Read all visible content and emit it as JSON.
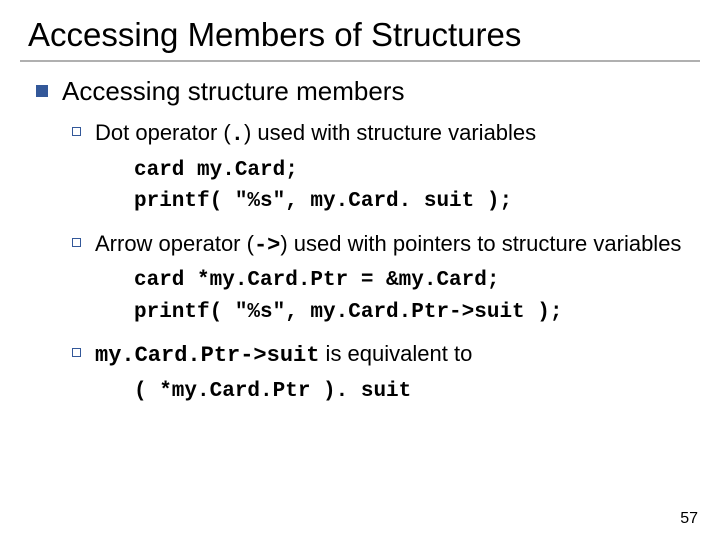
{
  "title": "Accessing Members of Structures",
  "section": "Accessing structure members",
  "items": [
    {
      "prefix": "Dot operator (",
      "op": ".",
      "suffix": ") used with structure variables",
      "code": "card my.Card;\nprintf( \"%s\", my.Card. suit );"
    },
    {
      "prefix": "Arrow operator (",
      "op": "->",
      "suffix": ") used with pointers to structure variables",
      "code": "card *my.Card.Ptr = &my.Card;\nprintf( \"%s\", my.Card.Ptr->suit );"
    },
    {
      "equiv_expr": "my.Card.Ptr->suit",
      "equiv_tail": " is equivalent to",
      "code": "( *my.Card.Ptr ). suit"
    }
  ],
  "page": "57"
}
